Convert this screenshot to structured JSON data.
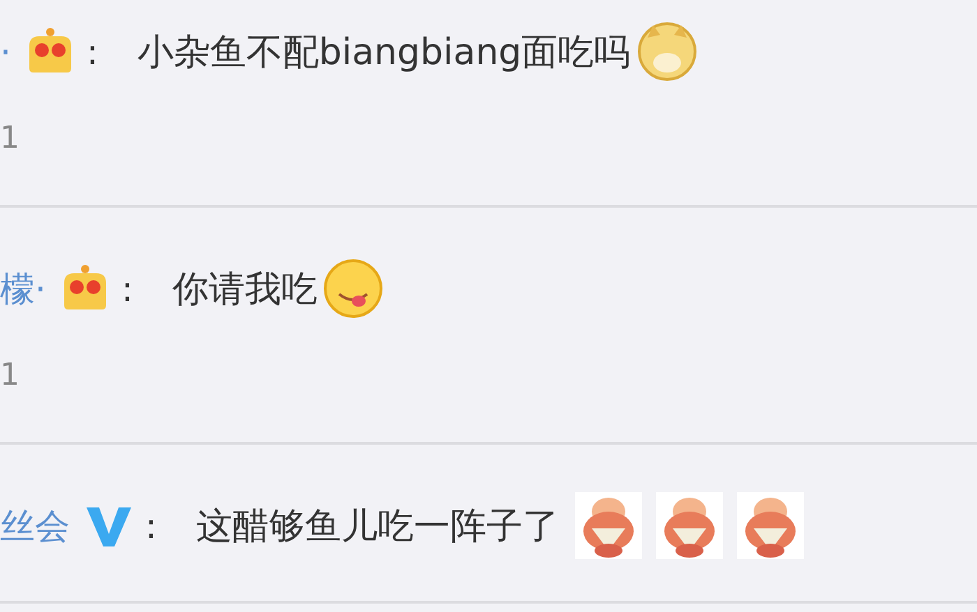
{
  "comments": [
    {
      "name": "·",
      "badge": {
        "kind": "crown"
      },
      "separator": ":",
      "text": "小杂鱼不配biangbiang面吃吗",
      "emojis": [
        {
          "kind": "doge"
        }
      ],
      "count": "1"
    },
    {
      "name": "檬·",
      "badge": {
        "kind": "crown"
      },
      "separator": ":",
      "text": "你请我吃",
      "emojis": [
        {
          "kind": "tongue"
        }
      ],
      "count": "1"
    },
    {
      "name": "丝会",
      "badge": {
        "kind": "verified"
      },
      "separator": ":",
      "text": "这醋够鱼儿吃一阵子了",
      "emojis": [
        {
          "kind": "fan"
        },
        {
          "kind": "fan"
        },
        {
          "kind": "fan"
        }
      ]
    }
  ]
}
